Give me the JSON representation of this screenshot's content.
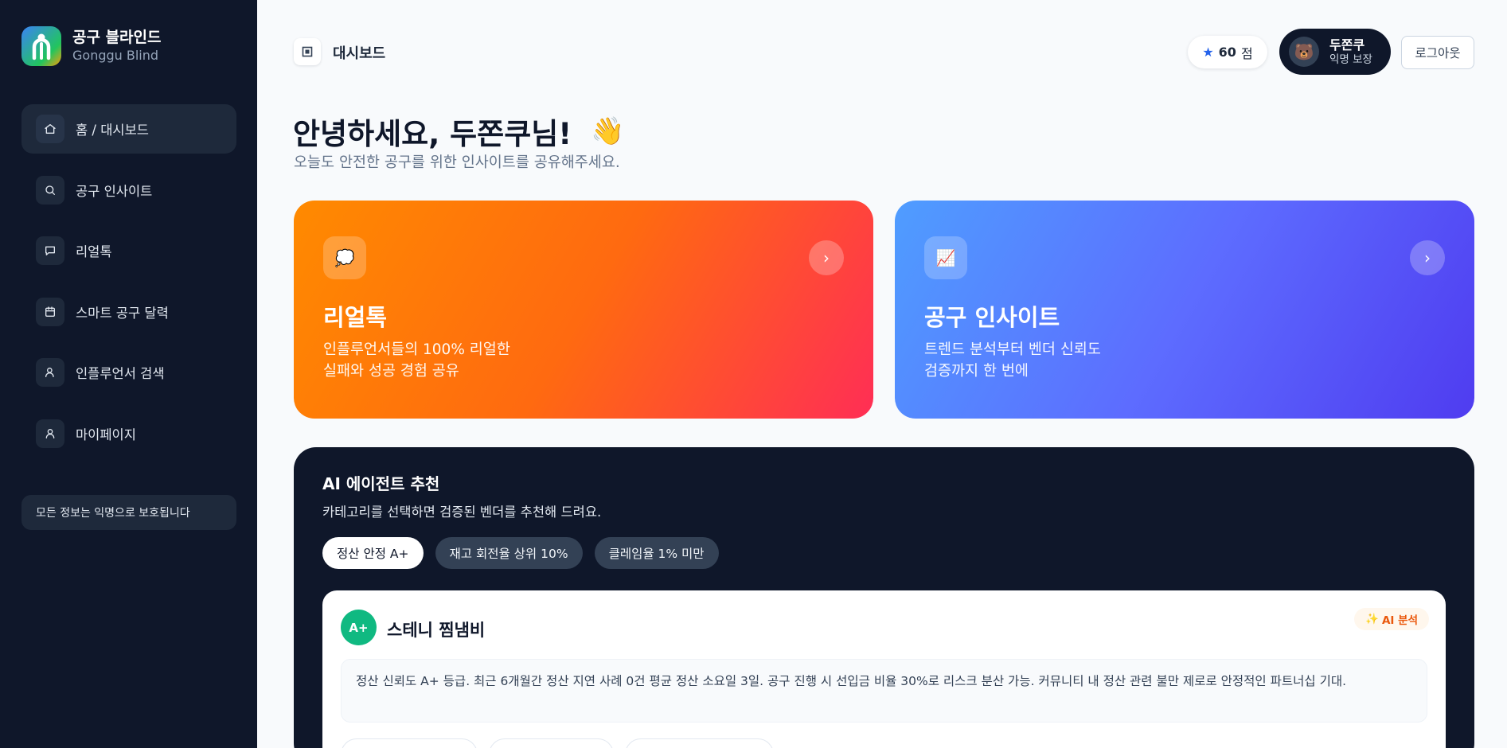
{
  "brand": {
    "title": "공구 블라인드",
    "subtitle": "Gonggu Blind"
  },
  "sidebar": {
    "items": [
      {
        "label": "홈 / 대시보드",
        "icon": "home-icon",
        "active": true
      },
      {
        "label": "공구 인사이트",
        "icon": "search-icon",
        "active": false
      },
      {
        "label": "리얼톡",
        "icon": "chat-bubble-icon",
        "active": false
      },
      {
        "label": "스마트 공구 달력",
        "icon": "calendar-icon",
        "active": false
      },
      {
        "label": "인플루언서 검색",
        "icon": "user-search-icon",
        "active": false
      },
      {
        "label": "마이페이지",
        "icon": "user-icon",
        "active": false
      }
    ],
    "privacy_note": "모든 정보는 익명으로 보호됩니다"
  },
  "header": {
    "breadcrumb": "대시보드",
    "breadcrumb_icon": "dashboard-icon",
    "points_value": "60",
    "points_unit": "점",
    "profile_avatar": "🐻",
    "profile_name": "두쫀쿠",
    "profile_sub": "익명 보장",
    "logout_label": "로그아웃"
  },
  "greeting": {
    "title": "안녕하세요, 두쫀쿠님!",
    "emoji": "👋",
    "subtitle": "오늘도 안전한 공구를 위한 인사이트를 공유해주세요."
  },
  "cards": [
    {
      "title": "리얼톡",
      "line1": "인플루언서들의 100% 리얼한",
      "line2": "실패와 성공 경험 공유",
      "icon": "💭",
      "arrow": "›",
      "accent": "#ff7a00"
    },
    {
      "title": "공구 인사이트",
      "line1": "트렌드 분석부터 벤더 신뢰도",
      "line2": "검증까지 한 번에",
      "icon": "📈",
      "arrow": "›",
      "accent": "#5b63ff"
    }
  ],
  "ai": {
    "title": "AI 에이전트 추천",
    "subtitle": "카테고리를 선택하면 검증된 벤더를 추천해 드려요.",
    "chips": [
      {
        "label": "정산 안정 A+",
        "active": true
      },
      {
        "label": "재고 회전율 상위 10%",
        "active": false
      },
      {
        "label": "클레임율 1% 미만",
        "active": false
      }
    ],
    "vendor": {
      "grade": "A+",
      "name": "스테니 찜냄비",
      "badge": "AI 분석",
      "badge_icon": "✨",
      "description": "정산 신뢰도 A+ 등급. 최근 6개월간 정산 지연 사례 0건 평균 정산 소요일 3일. 공구 진행 시 선입금 비율 30%로 리스크 분산 가능. 커뮤니티 내 정산 관련 불만 제로로 안정적인 파트너십 기대."
    }
  }
}
